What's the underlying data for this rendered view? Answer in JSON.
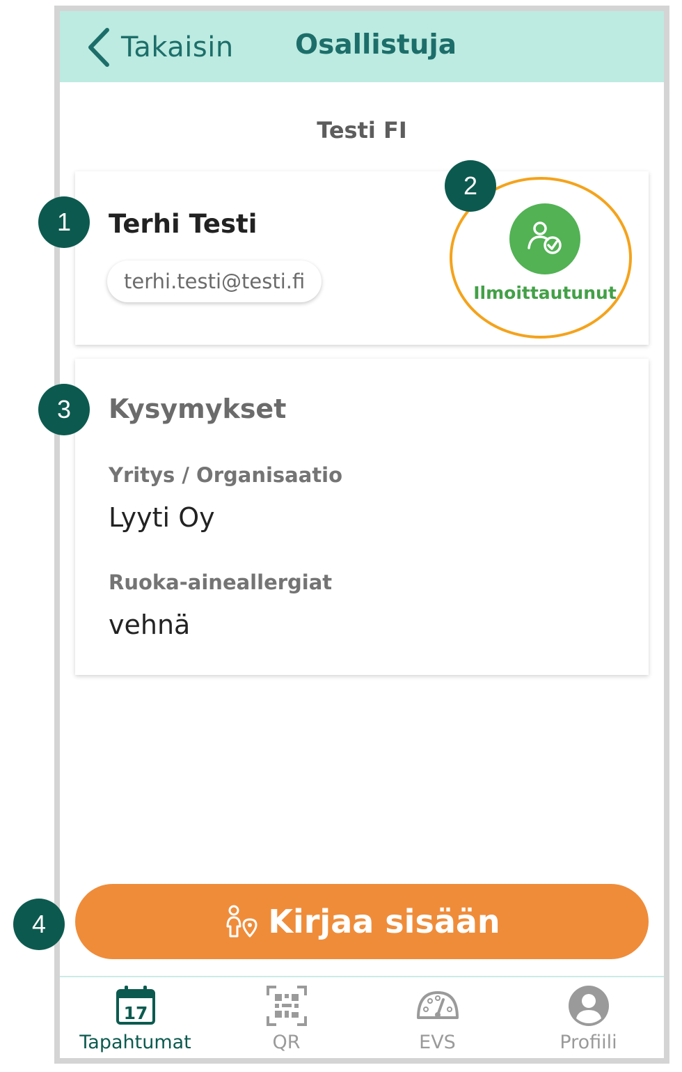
{
  "header": {
    "back_label": "Takaisin",
    "title": "Osallistuja"
  },
  "event": {
    "name": "Testi FI"
  },
  "participant": {
    "name": "Terhi Testi",
    "email": "terhi.testi@testi.fi",
    "status_label": "Ilmoittautunut"
  },
  "questions": {
    "title": "Kysymykset",
    "items": [
      {
        "label": "Yritys / Organisaatio",
        "value": "Lyyti Oy"
      },
      {
        "label": "Ruoka-aineallergiat",
        "value": "vehnä"
      }
    ]
  },
  "action": {
    "label": "Kirjaa sisään"
  },
  "tabs": [
    {
      "label": "Tapahtumat",
      "icon": "calendar-icon",
      "calendar_day": "17",
      "active": true
    },
    {
      "label": "QR",
      "icon": "qr-code-icon",
      "active": false
    },
    {
      "label": "EVS",
      "icon": "gauge-icon",
      "active": false
    },
    {
      "label": "Profiili",
      "icon": "profile-icon",
      "active": false
    }
  ],
  "annotations": [
    "1",
    "2",
    "3",
    "4"
  ],
  "colors": {
    "header_bg": "#bdebe1",
    "header_text": "#1d6e6a",
    "status_green": "#52b254",
    "highlight_ring": "#f4a31c",
    "cta_orange": "#ef8c3a",
    "active_tab": "#0c5a4f",
    "inactive_tab": "#9a9a9a",
    "badge_bg": "#0c5a4f"
  }
}
